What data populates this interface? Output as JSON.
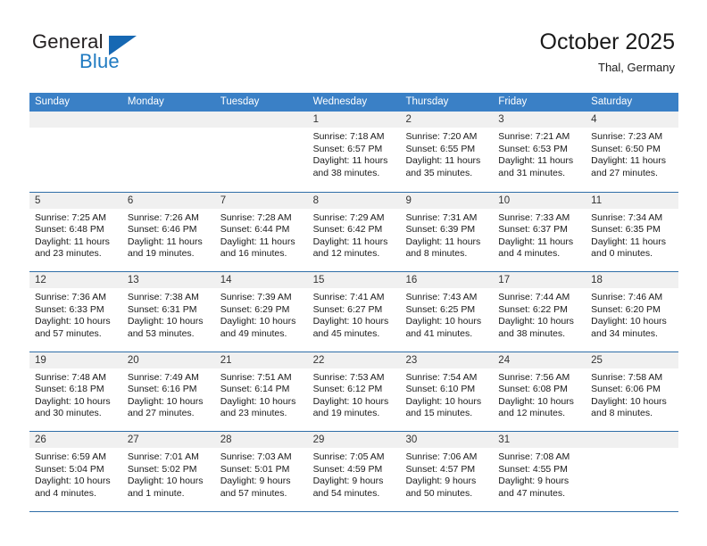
{
  "logo": {
    "word_top": "General",
    "word_bottom": "Blue",
    "flag_icon": "blue-triangle-flag-icon",
    "accent_color": "#1668b3",
    "text_color": "#231f20"
  },
  "header": {
    "title": "October 2025",
    "subtitle": "Thal, Germany"
  },
  "theme": {
    "header_row_bg": "#3a80c6",
    "row_rule": "#2f6ea8",
    "day_band_bg": "#f0f0f0"
  },
  "calendar": {
    "weekdays": [
      "Sunday",
      "Monday",
      "Tuesday",
      "Wednesday",
      "Thursday",
      "Friday",
      "Saturday"
    ],
    "weeks": [
      [
        {
          "day": "",
          "empty": true,
          "lines": []
        },
        {
          "day": "",
          "empty": true,
          "lines": []
        },
        {
          "day": "",
          "empty": true,
          "lines": []
        },
        {
          "day": "1",
          "empty": false,
          "lines": [
            "Sunrise: 7:18 AM",
            "Sunset: 6:57 PM",
            "Daylight: 11 hours",
            "and 38 minutes."
          ]
        },
        {
          "day": "2",
          "empty": false,
          "lines": [
            "Sunrise: 7:20 AM",
            "Sunset: 6:55 PM",
            "Daylight: 11 hours",
            "and 35 minutes."
          ]
        },
        {
          "day": "3",
          "empty": false,
          "lines": [
            "Sunrise: 7:21 AM",
            "Sunset: 6:53 PM",
            "Daylight: 11 hours",
            "and 31 minutes."
          ]
        },
        {
          "day": "4",
          "empty": false,
          "lines": [
            "Sunrise: 7:23 AM",
            "Sunset: 6:50 PM",
            "Daylight: 11 hours",
            "and 27 minutes."
          ]
        }
      ],
      [
        {
          "day": "5",
          "empty": false,
          "lines": [
            "Sunrise: 7:25 AM",
            "Sunset: 6:48 PM",
            "Daylight: 11 hours",
            "and 23 minutes."
          ]
        },
        {
          "day": "6",
          "empty": false,
          "lines": [
            "Sunrise: 7:26 AM",
            "Sunset: 6:46 PM",
            "Daylight: 11 hours",
            "and 19 minutes."
          ]
        },
        {
          "day": "7",
          "empty": false,
          "lines": [
            "Sunrise: 7:28 AM",
            "Sunset: 6:44 PM",
            "Daylight: 11 hours",
            "and 16 minutes."
          ]
        },
        {
          "day": "8",
          "empty": false,
          "lines": [
            "Sunrise: 7:29 AM",
            "Sunset: 6:42 PM",
            "Daylight: 11 hours",
            "and 12 minutes."
          ]
        },
        {
          "day": "9",
          "empty": false,
          "lines": [
            "Sunrise: 7:31 AM",
            "Sunset: 6:39 PM",
            "Daylight: 11 hours",
            "and 8 minutes."
          ]
        },
        {
          "day": "10",
          "empty": false,
          "lines": [
            "Sunrise: 7:33 AM",
            "Sunset: 6:37 PM",
            "Daylight: 11 hours",
            "and 4 minutes."
          ]
        },
        {
          "day": "11",
          "empty": false,
          "lines": [
            "Sunrise: 7:34 AM",
            "Sunset: 6:35 PM",
            "Daylight: 11 hours",
            "and 0 minutes."
          ]
        }
      ],
      [
        {
          "day": "12",
          "empty": false,
          "lines": [
            "Sunrise: 7:36 AM",
            "Sunset: 6:33 PM",
            "Daylight: 10 hours",
            "and 57 minutes."
          ]
        },
        {
          "day": "13",
          "empty": false,
          "lines": [
            "Sunrise: 7:38 AM",
            "Sunset: 6:31 PM",
            "Daylight: 10 hours",
            "and 53 minutes."
          ]
        },
        {
          "day": "14",
          "empty": false,
          "lines": [
            "Sunrise: 7:39 AM",
            "Sunset: 6:29 PM",
            "Daylight: 10 hours",
            "and 49 minutes."
          ]
        },
        {
          "day": "15",
          "empty": false,
          "lines": [
            "Sunrise: 7:41 AM",
            "Sunset: 6:27 PM",
            "Daylight: 10 hours",
            "and 45 minutes."
          ]
        },
        {
          "day": "16",
          "empty": false,
          "lines": [
            "Sunrise: 7:43 AM",
            "Sunset: 6:25 PM",
            "Daylight: 10 hours",
            "and 41 minutes."
          ]
        },
        {
          "day": "17",
          "empty": false,
          "lines": [
            "Sunrise: 7:44 AM",
            "Sunset: 6:22 PM",
            "Daylight: 10 hours",
            "and 38 minutes."
          ]
        },
        {
          "day": "18",
          "empty": false,
          "lines": [
            "Sunrise: 7:46 AM",
            "Sunset: 6:20 PM",
            "Daylight: 10 hours",
            "and 34 minutes."
          ]
        }
      ],
      [
        {
          "day": "19",
          "empty": false,
          "lines": [
            "Sunrise: 7:48 AM",
            "Sunset: 6:18 PM",
            "Daylight: 10 hours",
            "and 30 minutes."
          ]
        },
        {
          "day": "20",
          "empty": false,
          "lines": [
            "Sunrise: 7:49 AM",
            "Sunset: 6:16 PM",
            "Daylight: 10 hours",
            "and 27 minutes."
          ]
        },
        {
          "day": "21",
          "empty": false,
          "lines": [
            "Sunrise: 7:51 AM",
            "Sunset: 6:14 PM",
            "Daylight: 10 hours",
            "and 23 minutes."
          ]
        },
        {
          "day": "22",
          "empty": false,
          "lines": [
            "Sunrise: 7:53 AM",
            "Sunset: 6:12 PM",
            "Daylight: 10 hours",
            "and 19 minutes."
          ]
        },
        {
          "day": "23",
          "empty": false,
          "lines": [
            "Sunrise: 7:54 AM",
            "Sunset: 6:10 PM",
            "Daylight: 10 hours",
            "and 15 minutes."
          ]
        },
        {
          "day": "24",
          "empty": false,
          "lines": [
            "Sunrise: 7:56 AM",
            "Sunset: 6:08 PM",
            "Daylight: 10 hours",
            "and 12 minutes."
          ]
        },
        {
          "day": "25",
          "empty": false,
          "lines": [
            "Sunrise: 7:58 AM",
            "Sunset: 6:06 PM",
            "Daylight: 10 hours",
            "and 8 minutes."
          ]
        }
      ],
      [
        {
          "day": "26",
          "empty": false,
          "lines": [
            "Sunrise: 6:59 AM",
            "Sunset: 5:04 PM",
            "Daylight: 10 hours",
            "and 4 minutes."
          ]
        },
        {
          "day": "27",
          "empty": false,
          "lines": [
            "Sunrise: 7:01 AM",
            "Sunset: 5:02 PM",
            "Daylight: 10 hours",
            "and 1 minute."
          ]
        },
        {
          "day": "28",
          "empty": false,
          "lines": [
            "Sunrise: 7:03 AM",
            "Sunset: 5:01 PM",
            "Daylight: 9 hours",
            "and 57 minutes."
          ]
        },
        {
          "day": "29",
          "empty": false,
          "lines": [
            "Sunrise: 7:05 AM",
            "Sunset: 4:59 PM",
            "Daylight: 9 hours",
            "and 54 minutes."
          ]
        },
        {
          "day": "30",
          "empty": false,
          "lines": [
            "Sunrise: 7:06 AM",
            "Sunset: 4:57 PM",
            "Daylight: 9 hours",
            "and 50 minutes."
          ]
        },
        {
          "day": "31",
          "empty": false,
          "lines": [
            "Sunrise: 7:08 AM",
            "Sunset: 4:55 PM",
            "Daylight: 9 hours",
            "and 47 minutes."
          ]
        },
        {
          "day": "",
          "empty": true,
          "lines": []
        }
      ]
    ]
  }
}
